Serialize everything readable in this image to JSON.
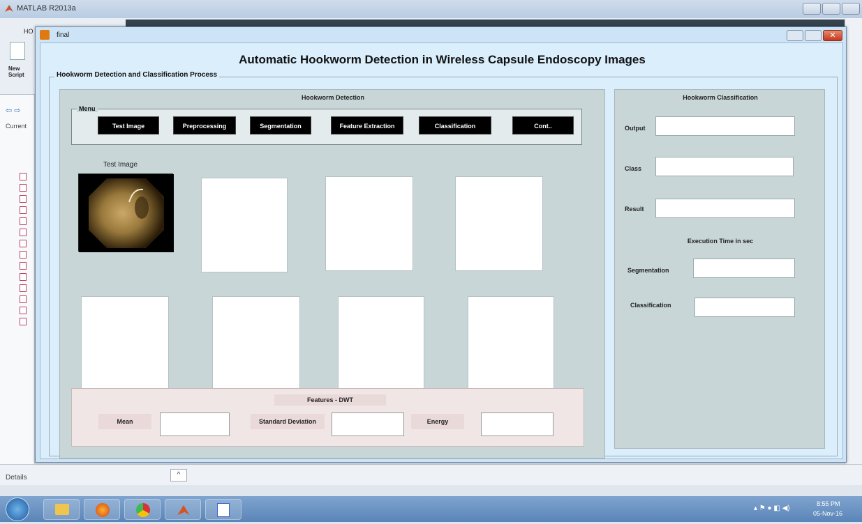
{
  "matlab": {
    "title": "MATLAB R2013a",
    "home_tab": "HO",
    "new_script_label": "New\nScript",
    "current_folder_label": "Current",
    "details_label": "Details"
  },
  "figure": {
    "window_title": "final",
    "main_title": "Automatic Hookworm Detection in Wireless Capsule Endoscopy Images",
    "process_label": "Hookworm Detection and Classification Process"
  },
  "detection": {
    "title": "Hookworm Detection",
    "menu_label": "Menu",
    "buttons": [
      "Test Image",
      "Preprocessing",
      "Segmentation",
      "Feature Extraction",
      "Classification",
      "Cont.."
    ],
    "test_image_label": "Test Image"
  },
  "features": {
    "title": "Features - DWT",
    "mean_label": "Mean",
    "std_label": "Standard Deviation",
    "energy_label": "Energy"
  },
  "classification": {
    "title": "Hookworm Classification",
    "output_label": "Output",
    "class_label": "Class",
    "result_label": "Result",
    "exec_title": "Execution Time in sec",
    "segmentation_label": "Segmentation",
    "classification_label": "Classification"
  },
  "taskbar": {
    "time": "8:55 PM",
    "date": "05-Nov-16"
  }
}
